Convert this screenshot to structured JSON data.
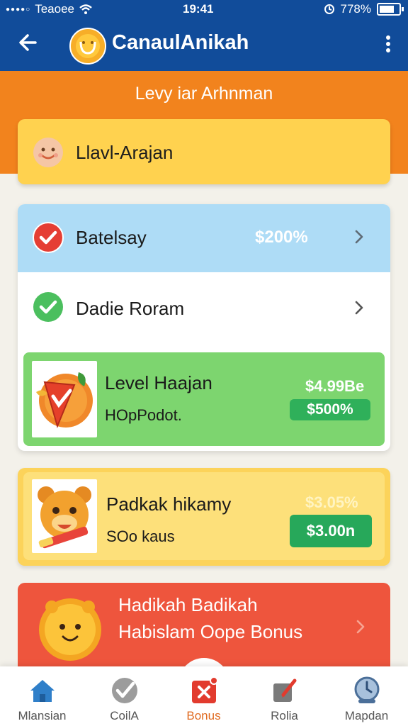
{
  "status_bar": {
    "carrier": "Teaoee",
    "time": "19:41",
    "battery": "778%"
  },
  "app_bar": {
    "title": "CanaulAnikah",
    "back_icon": "back-arrow-icon",
    "more_icon": "more-vertical-icon"
  },
  "banner": {
    "title": "Levy iar Arhnman"
  },
  "level_card": {
    "label": "Llavl-Arajan",
    "icon": "smiley-face-icon"
  },
  "list": {
    "rows": [
      {
        "label": "Batelsay",
        "amount": "$200%",
        "icon": "red-check-icon"
      },
      {
        "label": "Dadie Roram",
        "icon": "green-check-icon"
      }
    ],
    "featured": {
      "title": "Level Haajan",
      "subtitle": "HOpPodot.",
      "price": "$4.99Be",
      "button": "$500%"
    }
  },
  "offer": {
    "title": "Padkak hikamy",
    "subtitle": "SOo kaus",
    "price": "$3.05%",
    "button": "$3.00n"
  },
  "bonus_card": {
    "line1": "Hadikah Badikah",
    "line2": "Habislam Oope Bonus"
  },
  "bottom_nav": {
    "items": [
      {
        "label": "Mlansian",
        "icon": "home-icon",
        "color": "#2f7fc9"
      },
      {
        "label": "CoilA",
        "icon": "checkmark-badge-icon",
        "color": "#8b8b8b"
      },
      {
        "label": "Bonus",
        "icon": "gift-x-icon",
        "color": "#e23b2e",
        "active": true
      },
      {
        "label": "Rolia",
        "icon": "edit-pencil-icon",
        "color": "#7a7a7a"
      },
      {
        "label": "Mapdan",
        "icon": "clock-person-icon",
        "color": "#5a7fa8"
      }
    ]
  },
  "colors": {
    "app_bar": "#114c9a",
    "banner": "#f2831d",
    "level_card": "#ffd24f",
    "row_blue": "#aedcf6",
    "row_green": "#7dd56f",
    "button_green": "#2fb05a",
    "offer_yellow": "#fcd35a",
    "bonus_red": "#ee553d"
  }
}
